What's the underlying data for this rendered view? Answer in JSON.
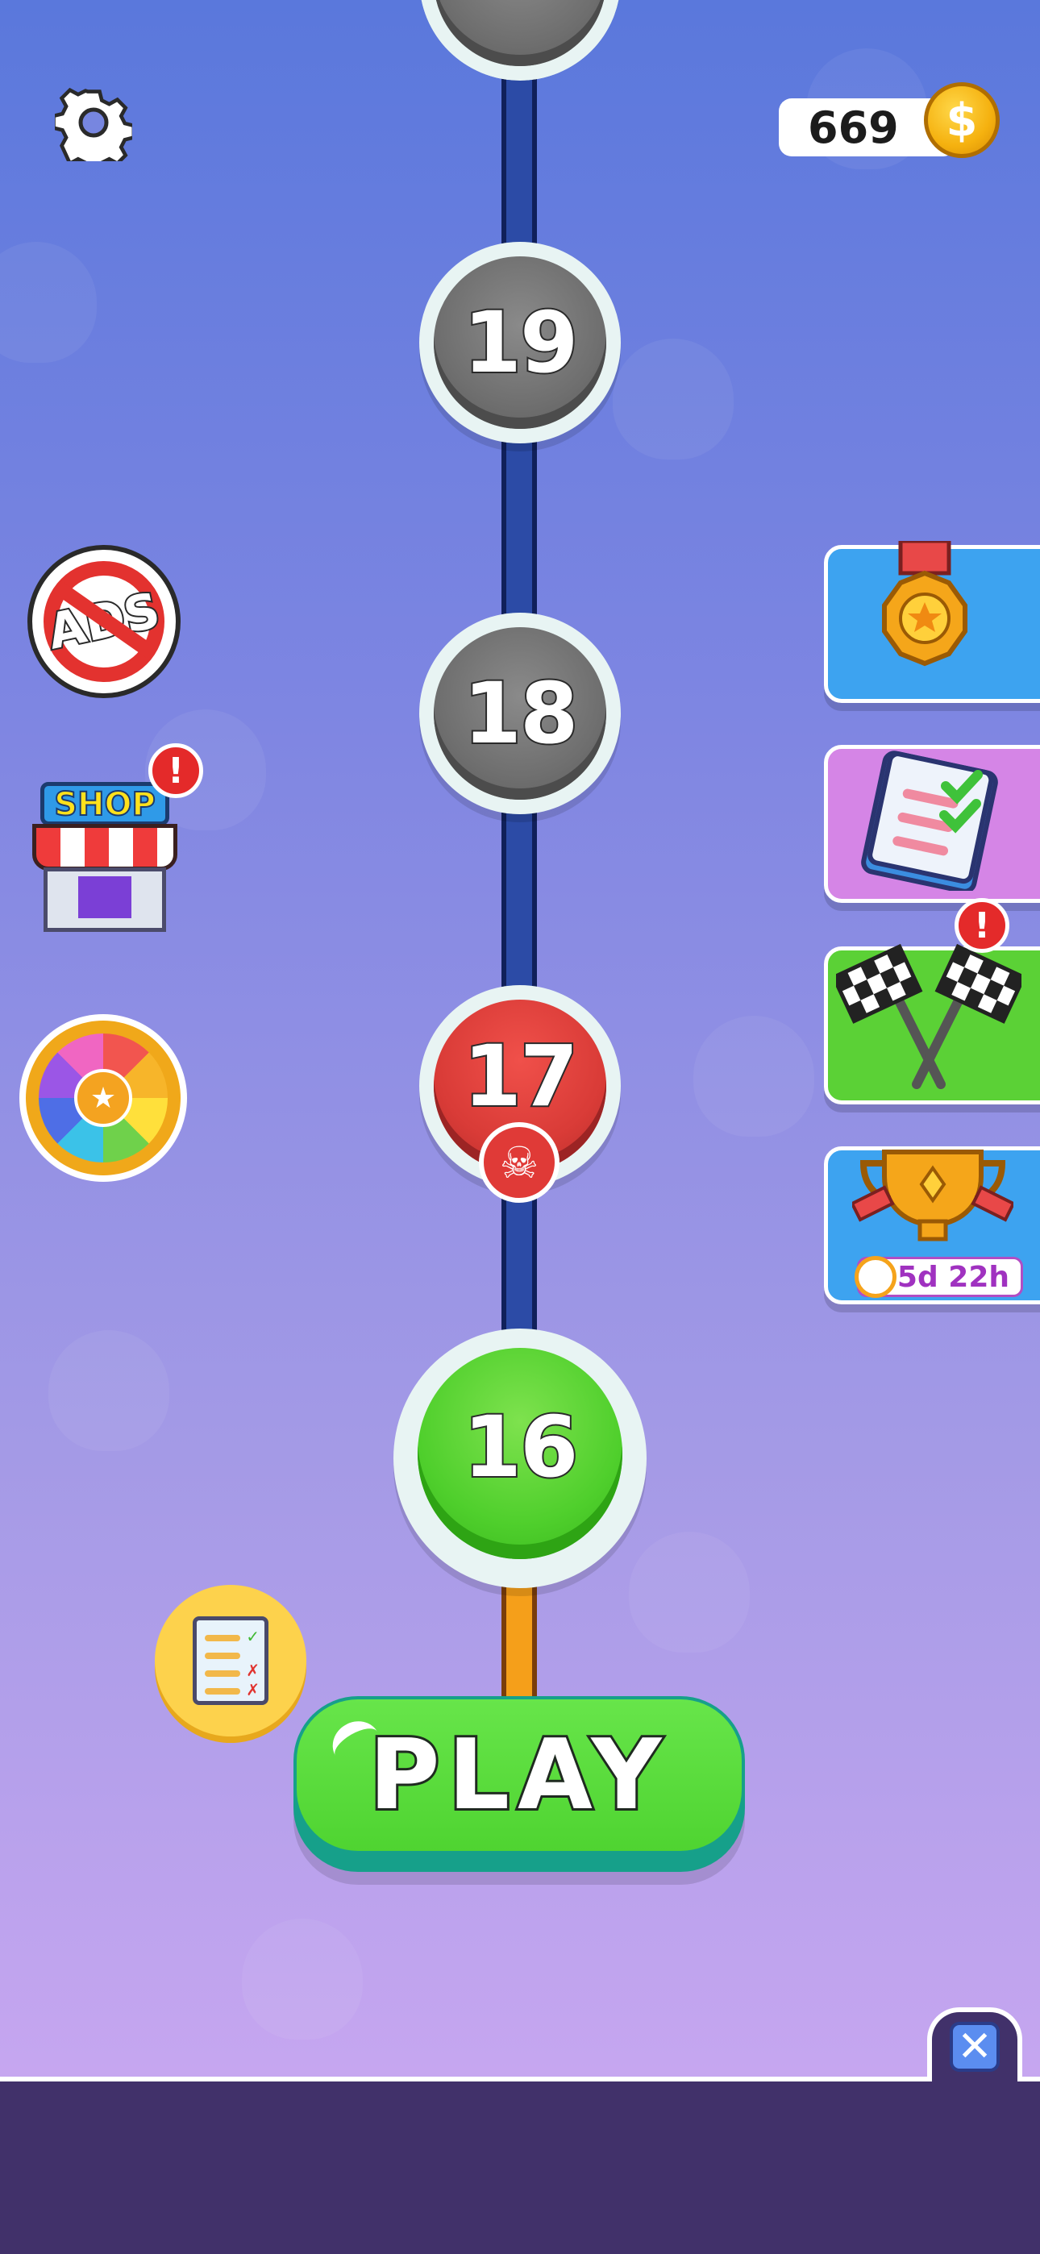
{
  "header": {
    "coin_count": "669",
    "coin_symbol": "$"
  },
  "levels": [
    {
      "number": "19",
      "state": "locked"
    },
    {
      "number": "18",
      "state": "locked"
    },
    {
      "number": "17",
      "state": "boss"
    },
    {
      "number": "16",
      "state": "current"
    }
  ],
  "left_menu": {
    "ads_label": "ADS",
    "shop_label": "SHOP",
    "alert_symbol": "!"
  },
  "right_menu": {
    "trophy_timer": "5d 22h",
    "race_alert": "!"
  },
  "play_button": {
    "label": "PLAY"
  },
  "colors": {
    "current_level": "#4fcf2c",
    "boss_level": "#d93b37",
    "locked_level": "#6f6f6f",
    "play": "#4fd431"
  }
}
